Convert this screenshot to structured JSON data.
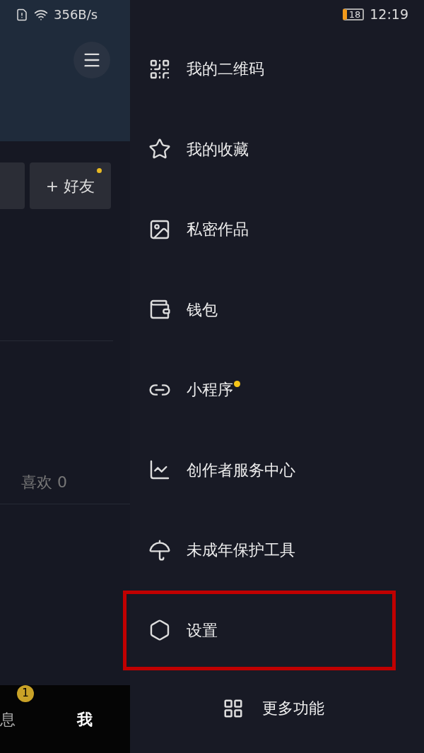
{
  "status_bar": {
    "net_speed": "356B/s",
    "battery": "18",
    "time": "12:19"
  },
  "profile": {
    "add_friend": "+ 好友",
    "add_friend_dot": true,
    "likes": "喜欢 0"
  },
  "bottom_tabs": [
    {
      "label": "息",
      "badge": "1",
      "selected": false
    },
    {
      "label": "我",
      "selected": true
    }
  ],
  "drawer": {
    "items": [
      {
        "kind": "qr",
        "label": "我的二维码",
        "dot": false,
        "highlighted": false
      },
      {
        "kind": "star",
        "label": "我的收藏",
        "dot": false,
        "highlighted": false
      },
      {
        "kind": "image",
        "label": "私密作品",
        "dot": false,
        "highlighted": false
      },
      {
        "kind": "wallet",
        "label": "钱包",
        "dot": false,
        "highlighted": false
      },
      {
        "kind": "link",
        "label": "小程序",
        "dot": true,
        "highlighted": false
      },
      {
        "kind": "chart",
        "label": "创作者服务中心",
        "dot": false,
        "highlighted": false
      },
      {
        "kind": "umbrella",
        "label": "未成年保护工具",
        "dot": false,
        "highlighted": false
      },
      {
        "kind": "settings",
        "label": "设置",
        "dot": false,
        "highlighted": true
      }
    ],
    "more": "更多功能"
  }
}
